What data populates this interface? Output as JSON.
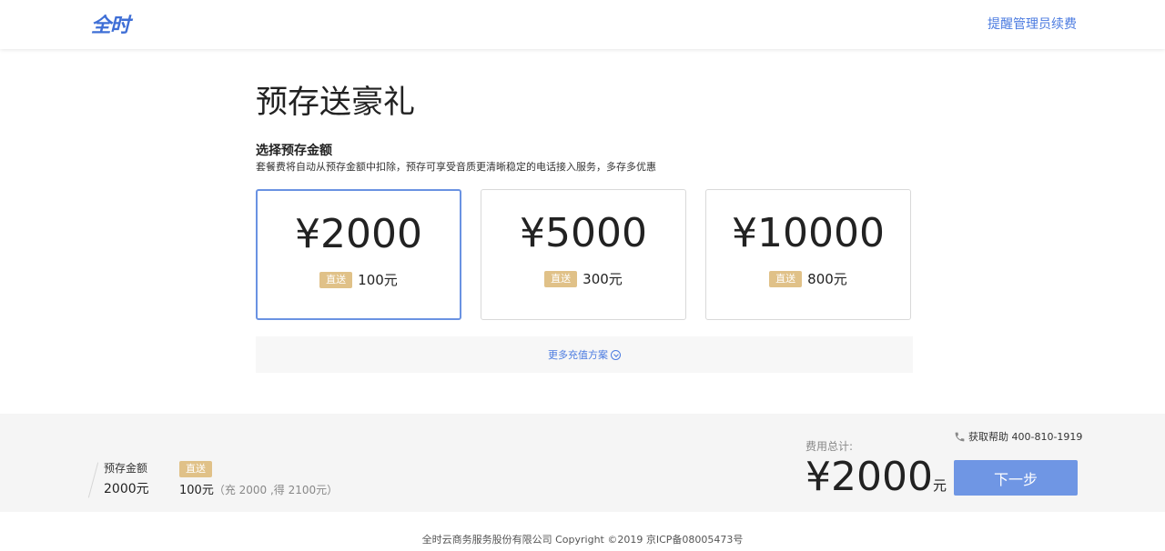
{
  "header": {
    "logo_text": "全时",
    "remind_link": "提醒管理员续费"
  },
  "main": {
    "title": "预存送豪礼",
    "section_title": "选择预存金额",
    "section_desc": "套餐费将自动从预存金额中扣除，预存可享受音质更清晰稳定的电话接入服务，多存多优惠",
    "cards": [
      {
        "price": "¥2000",
        "badge": "直送",
        "gift": "100元",
        "selected": true
      },
      {
        "price": "¥5000",
        "badge": "直送",
        "gift": "300元",
        "selected": false
      },
      {
        "price": "¥10000",
        "badge": "直送",
        "gift": "800元",
        "selected": false
      }
    ],
    "more_plans": "更多充值方案"
  },
  "summary": {
    "amount_label": "预存金额",
    "amount_value": "2000元",
    "badge": "直送",
    "gift_value": "100元",
    "gift_note": "（充 2000 ,得 2100元）",
    "total_label": "费用总计:",
    "total_value": "¥2000",
    "total_unit": "元",
    "help_text": "获取帮助 400-810-1919",
    "next_button": "下一步"
  },
  "footer": {
    "copyright": "全时云商务服务股份有限公司 Copyright ©2019 京ICP备08005473号"
  },
  "colors": {
    "accent": "#4b7be0",
    "button": "#6f96e4",
    "badge": "#e0c188",
    "selected_border": "#6a92e2"
  }
}
